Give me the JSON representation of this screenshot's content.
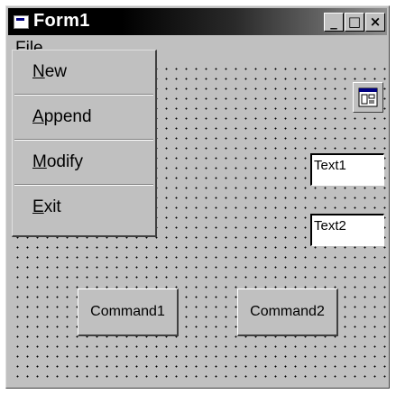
{
  "window": {
    "title": "Form1",
    "controls": {
      "minimize": "_",
      "maximize": "□",
      "close": "×"
    }
  },
  "menubar": {
    "file": "File"
  },
  "file_menu": {
    "items": [
      {
        "mnemonic": "N",
        "rest": "ew"
      },
      {
        "mnemonic": "A",
        "rest": "ppend"
      },
      {
        "mnemonic": "M",
        "rest": "odify"
      },
      {
        "mnemonic": "E",
        "rest": "xit"
      }
    ]
  },
  "form": {
    "text1": "Text1",
    "text2": "Text2",
    "command1": "Command1",
    "command2": "Command2",
    "control_icon": "component-icon"
  },
  "colors": {
    "face": "#c0c0c0",
    "title_start": "#000000",
    "title_end": "#8f8f8f"
  }
}
